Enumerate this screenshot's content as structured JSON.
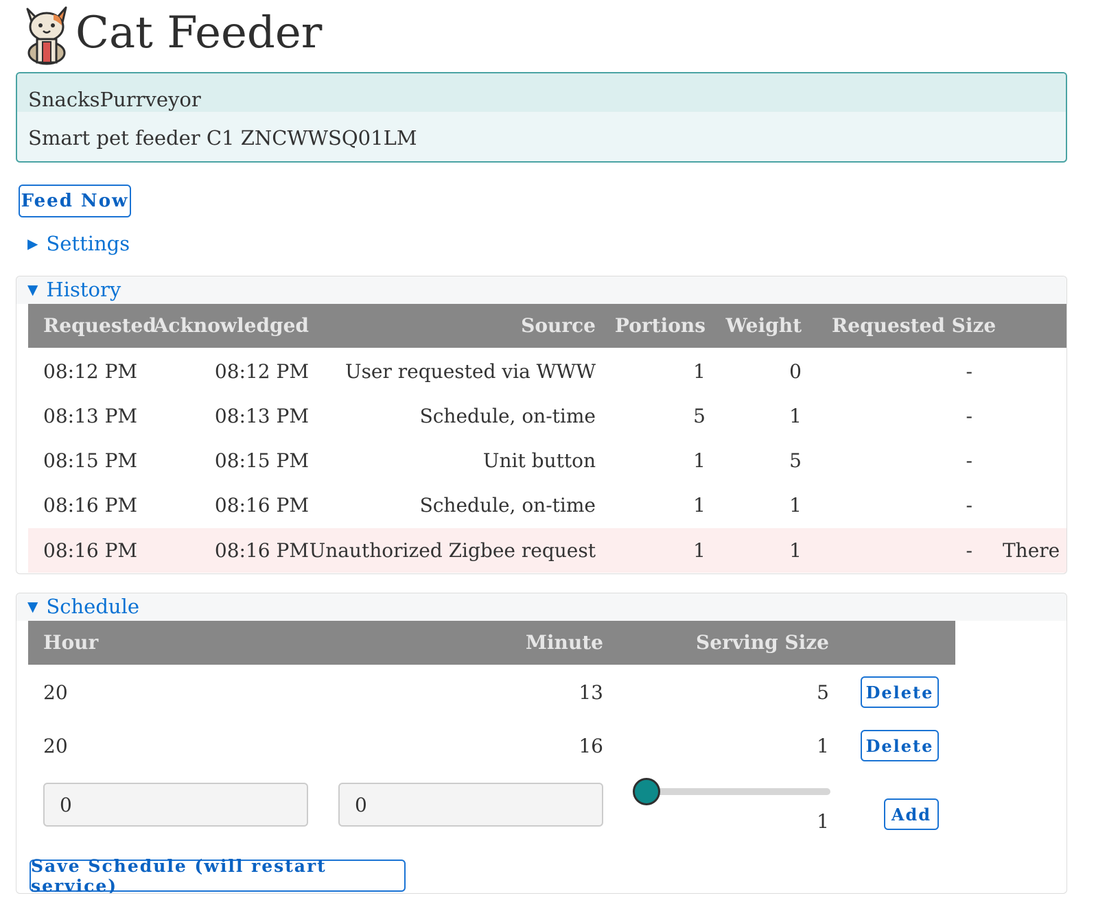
{
  "app": {
    "title": "Cat Feeder",
    "logo_icon": "cat-icon"
  },
  "device": {
    "name": "SnacksPurrveyor",
    "model": "Smart pet feeder C1 ZNCWWSQ01LM"
  },
  "actions": {
    "feed_now_label": "Feed Now"
  },
  "sections": {
    "settings_label": "Settings",
    "history_label": "History",
    "schedule_label": "Schedule",
    "collapsed_icon": "triangle-right-icon",
    "expanded_icon": "triangle-down-icon"
  },
  "history": {
    "columns": [
      "Requested",
      "Acknowledged",
      "Source",
      "Portions",
      "Weight",
      "Requested Size"
    ],
    "rows": [
      {
        "requested": "08:12 PM",
        "acknowledged": "08:12 PM",
        "source": "User requested via WWW",
        "portions": "1",
        "weight": "0",
        "requested_size": "-",
        "note": ""
      },
      {
        "requested": "08:13 PM",
        "acknowledged": "08:13 PM",
        "source": "Schedule, on-time",
        "portions": "5",
        "weight": "1",
        "requested_size": "-",
        "note": ""
      },
      {
        "requested": "08:15 PM",
        "acknowledged": "08:15 PM",
        "source": "Unit button",
        "portions": "1",
        "weight": "5",
        "requested_size": "-",
        "note": ""
      },
      {
        "requested": "08:16 PM",
        "acknowledged": "08:16 PM",
        "source": "Schedule, on-time",
        "portions": "1",
        "weight": "1",
        "requested_size": "-",
        "note": ""
      },
      {
        "requested": "08:16 PM",
        "acknowledged": "08:16 PM",
        "source": "Unauthorized Zigbee request",
        "portions": "1",
        "weight": "1",
        "requested_size": "-",
        "note": "There r"
      }
    ],
    "alert_row_color": "#fdeeee"
  },
  "schedule": {
    "columns": [
      "Hour",
      "Minute",
      "Serving Size"
    ],
    "rows": [
      {
        "hour": "20",
        "minute": "13",
        "serving_size": "5",
        "delete_label": "Delete"
      },
      {
        "hour": "20",
        "minute": "16",
        "serving_size": "1",
        "delete_label": "Delete"
      }
    ],
    "new_entry": {
      "hour_value": "0",
      "minute_value": "0",
      "serving_size_value": "1",
      "slider_fraction": 0.0,
      "add_label": "Add"
    },
    "save_label": "Save Schedule (will restart service)"
  },
  "colors": {
    "accent": "#0a72d4",
    "table_header_bg": "#878787",
    "device_box_bg": "#ecf6f7",
    "device_box_border": "#4aa3a3",
    "slider_thumb": "#0e8a8a"
  }
}
